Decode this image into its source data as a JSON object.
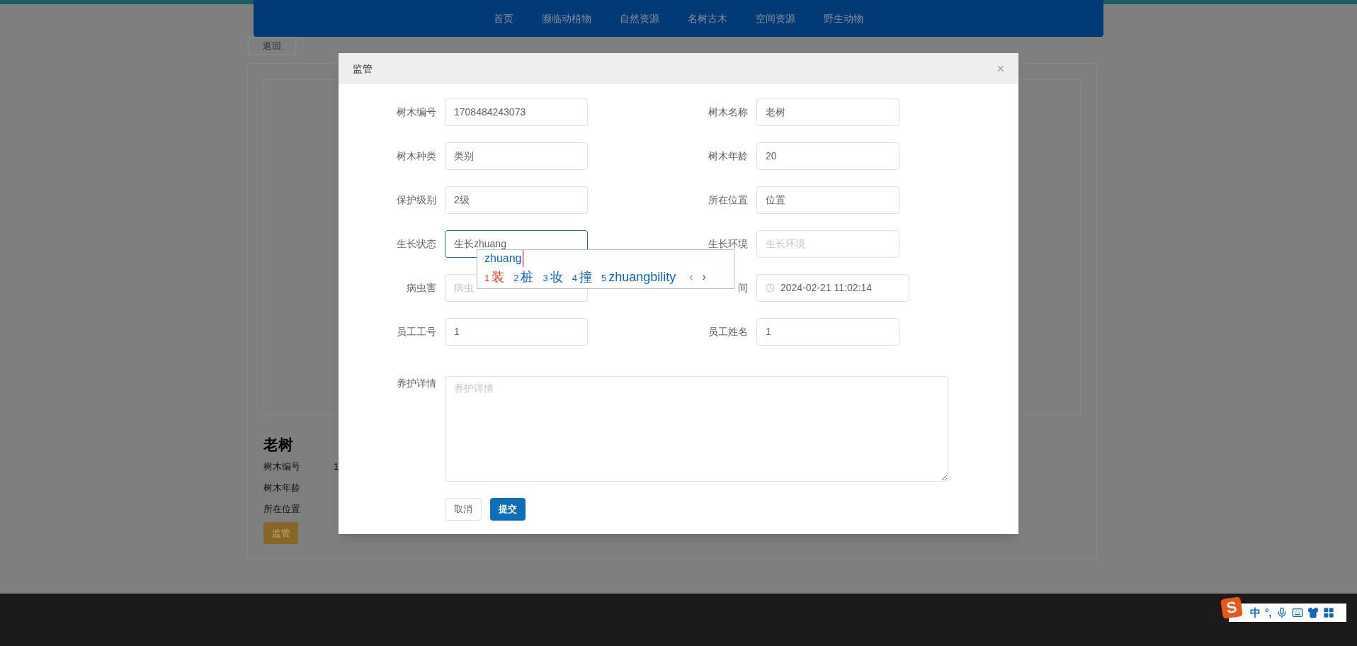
{
  "nav": {
    "items": [
      {
        "label": "首页",
        "selected": false
      },
      {
        "label": "濒临动植物",
        "selected": false
      },
      {
        "label": "自然资源",
        "selected": false
      },
      {
        "label": "名树古木",
        "selected": false
      },
      {
        "label": "空间资源",
        "selected": false
      },
      {
        "label": "野生动物",
        "selected": false
      }
    ]
  },
  "back_button": "返回",
  "detail": {
    "title": "老树",
    "rows": [
      {
        "label": "树木编号",
        "value": "1"
      },
      {
        "label": "树木年龄"
      },
      {
        "label": "所在位置"
      }
    ],
    "action_button": "监管"
  },
  "dialog": {
    "title": "监管",
    "close": "×",
    "fields": [
      {
        "kind": "text",
        "label": "树木编号",
        "value": "1708484243073",
        "focused": false
      },
      {
        "kind": "text",
        "label": "树木名称",
        "value": "老树",
        "focused": false
      },
      {
        "kind": "text",
        "label": "树木种类",
        "value": "类别",
        "focused": false
      },
      {
        "kind": "text",
        "label": "树木年龄",
        "value": "20",
        "focused": false
      },
      {
        "kind": "text",
        "label": "保护级别",
        "value": "2级",
        "focused": false
      },
      {
        "kind": "text",
        "label": "所在位置",
        "value": "位置",
        "focused": false
      },
      {
        "kind": "text",
        "label": "生长状态",
        "value": "生长zhuang",
        "focused": true
      },
      {
        "kind": "text",
        "label": "生长环境",
        "placeholder": "生长环境",
        "focused": false
      },
      {
        "kind": "text",
        "label": "病虫害",
        "placeholder": "病虫",
        "focused": false
      },
      {
        "kind": "date",
        "label": "间",
        "value": "2024-02-21 11:02:14",
        "focused": false
      },
      {
        "kind": "text",
        "label": "员工工号",
        "value": "1",
        "focused": false
      },
      {
        "kind": "text",
        "label": "员工姓名",
        "value": "1",
        "focused": false
      }
    ],
    "details": {
      "label": "养护详情",
      "placeholder": "养护详情"
    },
    "buttons": [
      {
        "kind": "default",
        "label": "取消"
      },
      {
        "kind": "primary",
        "label": "提交"
      }
    ]
  },
  "ime_popup": {
    "composition": "zhuang",
    "candidates": [
      {
        "number": "1",
        "text": "装",
        "selected": true
      },
      {
        "number": "2",
        "text": "桩",
        "selected": false
      },
      {
        "number": "3",
        "text": "妆",
        "selected": false
      },
      {
        "number": "4",
        "text": "撞",
        "selected": false
      },
      {
        "number": "5",
        "text": "zhuangbility",
        "selected": false
      }
    ],
    "prev": "‹",
    "next": "›"
  },
  "ime_toolbar": {
    "logo": "S",
    "mode": "中",
    "punctuation": "°,"
  }
}
